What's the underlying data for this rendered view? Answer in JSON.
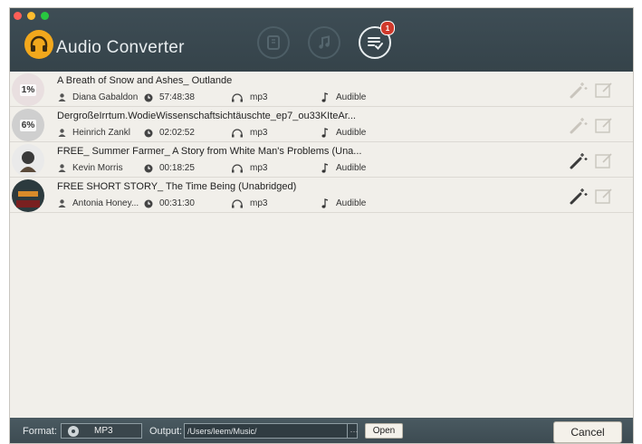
{
  "app": {
    "title": "Audio Converter"
  },
  "toolbar": {
    "badge_count": "1"
  },
  "items": [
    {
      "title": "A Breath of Snow and Ashes_ Outlande",
      "author": "Diana Gabaldon",
      "duration": "57:48:38",
      "format": "mp3",
      "source": "Audible",
      "progress_label": "1%",
      "cover_color": "#e9dfe0"
    },
    {
      "title": "DergroßeIrrtum.WodieWissenschaftsichtäuschte_ep7_ou33KIteAr...",
      "author": "Heinrich Zankl",
      "duration": "02:02:52",
      "format": "mp3",
      "source": "Audible",
      "progress_label": "6%",
      "cover_color": "#cfcfcf"
    },
    {
      "title": "FREE_ Summer Farmer_ A Story from White Man's Problems (Una...",
      "author": "Kevin Morris",
      "duration": "00:18:25",
      "format": "mp3",
      "source": "Audible",
      "progress_label": "",
      "cover_color": "#eaeaea"
    },
    {
      "title": "FREE SHORT STORY_ The Time Being (Unabridged)",
      "author": "Antonia Honey...",
      "duration": "00:31:30",
      "format": "mp3",
      "source": "Audible",
      "progress_label": "",
      "cover_color": "#2c3a3e"
    }
  ],
  "footer": {
    "format_label": "Format:",
    "format_value": "MP3",
    "output_label": "Output:",
    "output_path": "/Users/leem/Music/",
    "browse_label": "···",
    "open_label": "Open",
    "cancel_label": "Cancel"
  }
}
